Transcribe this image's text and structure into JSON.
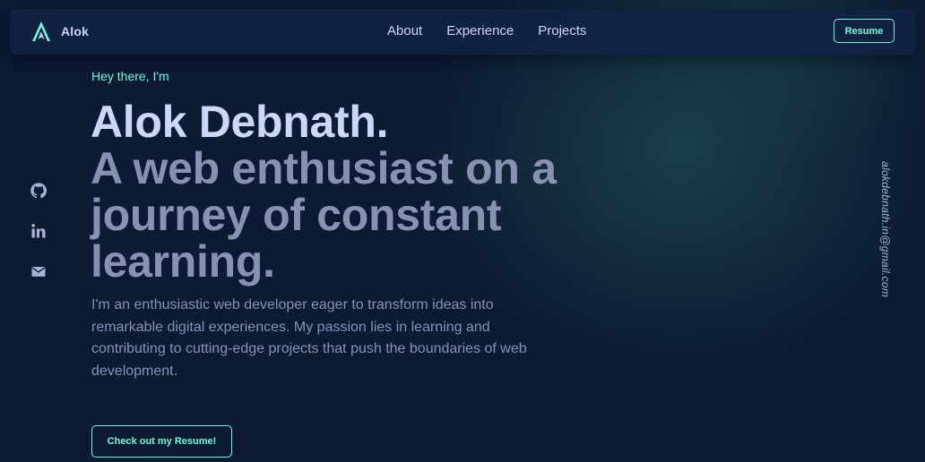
{
  "navbar": {
    "brand_name": "Alok",
    "links": [
      {
        "label": "About"
      },
      {
        "label": "Experience"
      },
      {
        "label": "Projects"
      }
    ],
    "resume_label": "Resume"
  },
  "hero": {
    "greeting": "Hey there, I'm",
    "name": "Alok Debnath.",
    "tagline": "A web enthusiast on a journey of constant learning.",
    "description": "I'm an enthusiastic web developer eager to transform ideas into remarkable digital experiences. My passion lies in learning and contributing to cutting-edge projects that push the boundaries of web development.",
    "cta_label": "Check out my Resume!"
  },
  "social": {
    "icons": [
      "github-icon",
      "linkedin-icon",
      "mail-icon"
    ]
  },
  "email": "alokdebnath.in@gmail.com",
  "colors": {
    "background": "#0c1a33",
    "navbar": "#112244",
    "accent": "#64ffda",
    "heading": "#ccd6f6",
    "muted": "#8892b0",
    "icon": "#a8b2d1"
  }
}
